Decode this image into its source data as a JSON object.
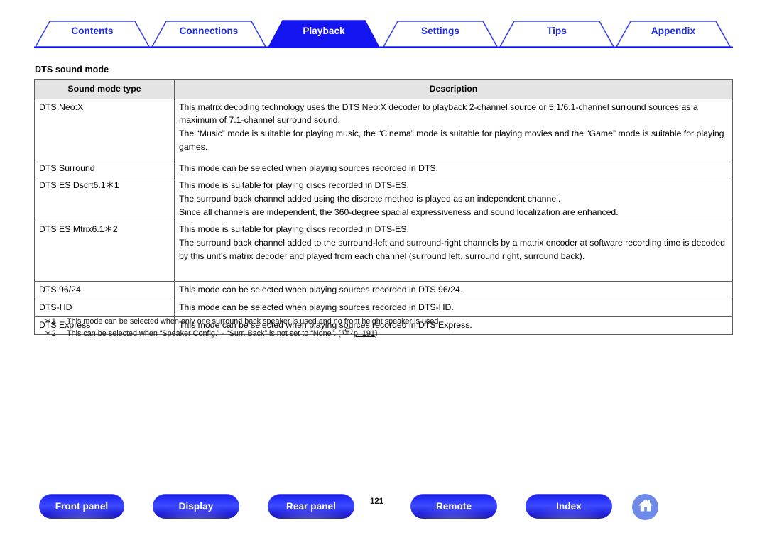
{
  "nav": {
    "tabs": [
      {
        "label": "Contents",
        "active": false
      },
      {
        "label": "Connections",
        "active": false
      },
      {
        "label": "Playback",
        "active": true
      },
      {
        "label": "Settings",
        "active": false
      },
      {
        "label": "Tips",
        "active": false
      },
      {
        "label": "Appendix",
        "active": false
      }
    ],
    "accent_color": "#1f2ce0",
    "active_tab_bg": "#1414f0",
    "active_tab_text": "#ffffff"
  },
  "section": {
    "title": "DTS sound mode"
  },
  "table": {
    "headers": [
      "Sound mode type",
      "Description"
    ],
    "header_bg": "#e4e4e4",
    "border_color": "#5c5c5c",
    "rows": [
      {
        "type": "DTS Neo:X",
        "description": [
          "This matrix decoding technology uses the DTS Neo:X decoder to playback 2-channel source or 5.1/6.1-channel surround sources as a maximum of 7.1-channel surround sound.",
          "The “Music” mode is suitable for playing music, the “Cinema” mode is suitable for playing movies and the “Game” mode is suitable for playing games."
        ]
      },
      {
        "type": "DTS Surround",
        "description": [
          "This mode can be selected when playing sources recorded in DTS."
        ]
      },
      {
        "type": "DTS ES Dscrt6.1＊1",
        "description": [
          "This mode is suitable for playing discs recorded in DTS-ES.",
          "The surround back channel added using the discrete method is played as an independent channel.",
          "Since all channels are independent, the 360-degree spacial expressiveness and sound localization are enhanced."
        ]
      },
      {
        "type": "DTS ES Mtrix6.1＊2",
        "description": [
          "This mode is suitable for playing discs recorded in DTS-ES.",
          "The surround back channel added to the surround-left and surround-right channels by a matrix encoder at software recording time is decoded by this unit’s matrix decoder and played from each channel (surround left, surround right, surround back)."
        ]
      },
      {
        "type": "DTS 96/24",
        "description": [
          "This mode can be selected when playing sources recorded in DTS 96/24."
        ]
      },
      {
        "type": "DTS-HD",
        "description": [
          "This mode can be selected when playing sources recorded in DTS-HD."
        ]
      },
      {
        "type": "DTS Express",
        "description": [
          "This mode can be selected when playing sources recorded in DTS Express."
        ]
      }
    ]
  },
  "footnotes": [
    {
      "mark": "＊1",
      "text": "This mode can be selected when only one surround back speaker is used and no front height speaker is used.",
      "page_ref": null,
      "tail": null
    },
    {
      "mark": "＊2",
      "text": "This can be selected when “Speaker Config.” - “Surr. Back” is not set to “None”.  (",
      "page_ref": "p. 191",
      "tail": ")"
    }
  ],
  "footer": {
    "buttons": [
      {
        "label": "Front panel"
      },
      {
        "label": "Display"
      },
      {
        "label": "Rear panel"
      },
      {
        "label": "Remote"
      },
      {
        "label": "Index"
      }
    ],
    "page_number": "121",
    "home_icon": "home-icon",
    "pill_color": "#2a36ff",
    "home_bg": "#6e8ae8"
  }
}
